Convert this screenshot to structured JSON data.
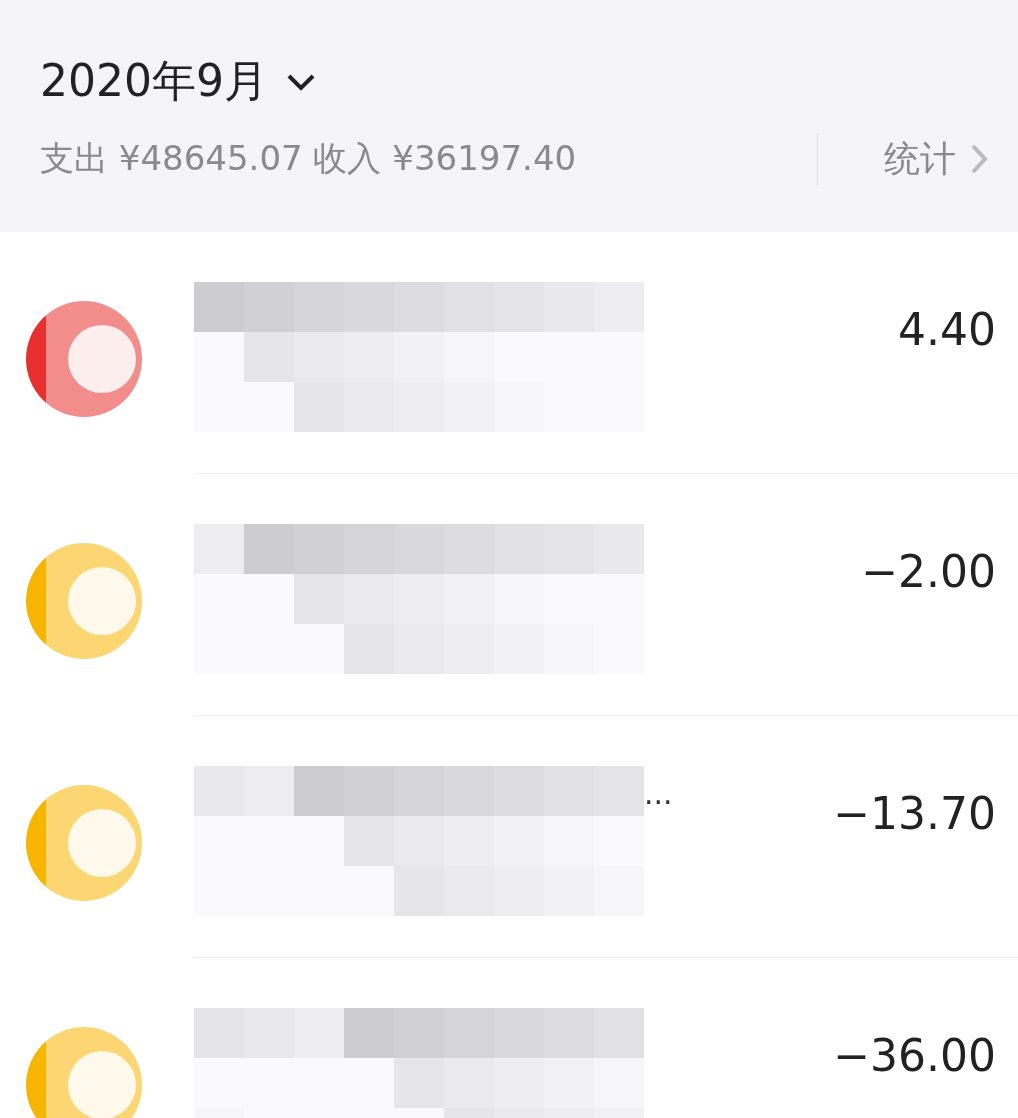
{
  "header": {
    "month": "2020年9月",
    "summary": "支出 ¥48645.07 收入 ¥36197.40",
    "stats_link": "统计"
  },
  "transactions": [
    {
      "color": "#e8312f",
      "amount": "4.40"
    },
    {
      "color": "#f7b500",
      "amount": "−2.00"
    },
    {
      "color": "#f7b500",
      "amount": "−13.70",
      "title_tail": "..."
    },
    {
      "color": "#f7b500",
      "amount": "−36.00"
    }
  ]
}
